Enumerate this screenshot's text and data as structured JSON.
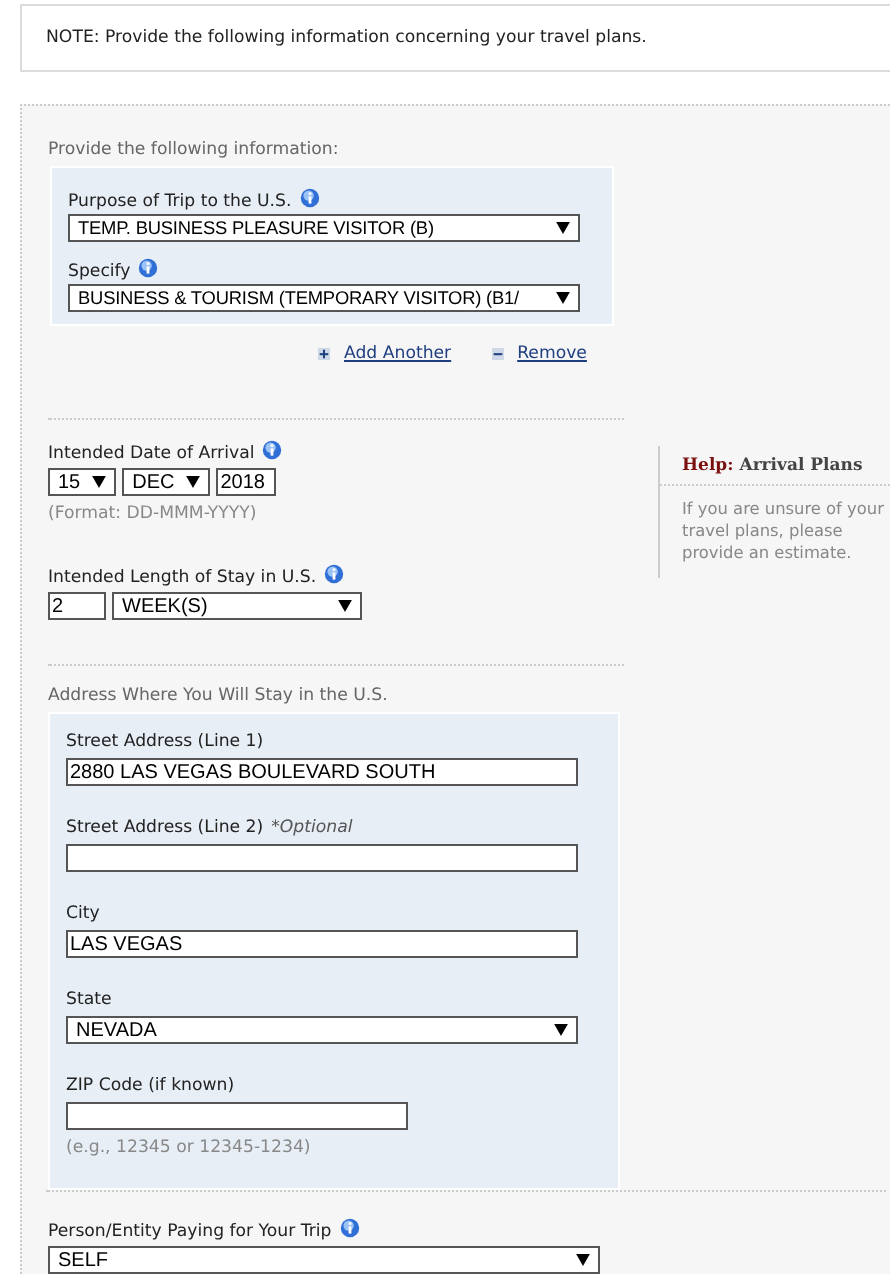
{
  "note": "NOTE: Provide the following information concerning your travel plans.",
  "purpose": {
    "heading": "Provide the following information:",
    "fields": [
      {
        "label": "Purpose of Trip to the U.S.",
        "value": "TEMP. BUSINESS PLEASURE VISITOR (B)"
      },
      {
        "label": "Specify",
        "value": "BUSINESS & TOURISM (TEMPORARY VISITOR) (B1/"
      }
    ],
    "actions": [
      {
        "kind": "add",
        "label": "Add Another"
      },
      {
        "kind": "remove",
        "label": "Remove"
      }
    ]
  },
  "arrival": {
    "label": "Intended Date of Arrival",
    "day": "15",
    "month": "DEC",
    "year": "2018",
    "format": "(Format: DD-MMM-YYYY)"
  },
  "stay": {
    "label": "Intended Length of Stay in U.S.",
    "number": "2",
    "unit": "WEEK(S)"
  },
  "help": {
    "prefix": "Help:",
    "title": "Arrival Plans",
    "text": "If you are unsure of your travel plans, please provide an estimate."
  },
  "address": {
    "heading": "Address Where You Will Stay in the U.S.",
    "fields": [
      {
        "kind": "input",
        "label": "Street Address (Line 1)",
        "value": "2880 LAS VEGAS BOULEVARD SOUTH"
      },
      {
        "kind": "input",
        "label": "Street Address (Line 2)",
        "optional": "*Optional"
      },
      {
        "kind": "input",
        "label": "City",
        "value": "LAS VEGAS"
      },
      {
        "kind": "select",
        "label": "State",
        "value": "NEVADA"
      },
      {
        "kind": "zip",
        "label": "ZIP Code (if known)",
        "hint": "(e.g., 12345 or 12345-1234)"
      }
    ]
  },
  "payer": {
    "label": "Person/Entity Paying for Your Trip",
    "value": "SELF"
  }
}
